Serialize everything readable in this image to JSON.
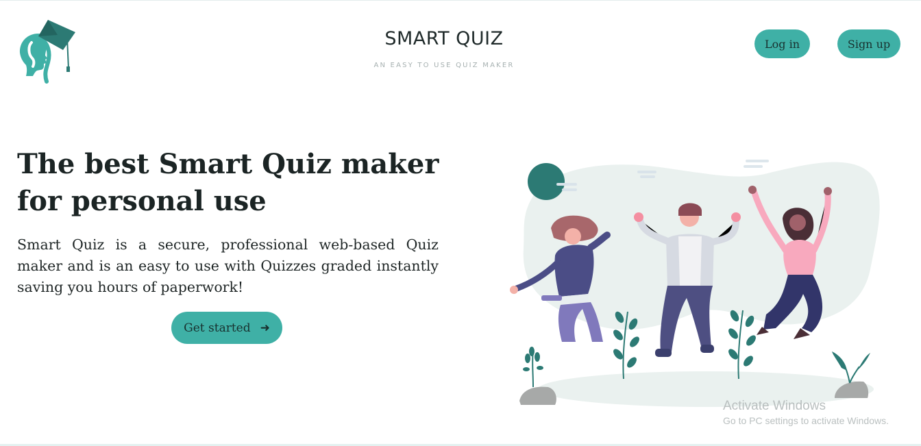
{
  "header": {
    "title": "SMART QUIZ",
    "tagline": "AN EASY TO USE QUIZ MAKER",
    "login_label": "Log in",
    "signup_label": "Sign up",
    "logo_icon": "graduate-head-icon"
  },
  "hero": {
    "heading": "The best Smart Quiz maker for personal use",
    "description": "Smart Quiz is a secure, professional web-based Quiz maker and is an easy to use with Quizzes graded instantly saving you hours of paperwork!",
    "cta_label": "Get started",
    "cta_icon": "arrow-right-icon"
  },
  "watermark": {
    "title": "Activate Windows",
    "subtitle": "Go to PC settings to activate Windows."
  },
  "colors": {
    "accent": "#3fb0a6",
    "accent_dark": "#2c7a74",
    "text": "#1b2424",
    "muted": "#a6b0b0"
  }
}
